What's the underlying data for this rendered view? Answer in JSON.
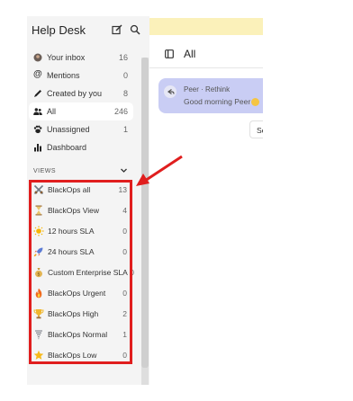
{
  "sidebar": {
    "title": "Help Desk",
    "nav": [
      {
        "label": "Your inbox",
        "count": "16"
      },
      {
        "label": "Mentions",
        "count": "0"
      },
      {
        "label": "Created by you",
        "count": "8"
      },
      {
        "label": "All",
        "count": "246"
      },
      {
        "label": "Unassigned",
        "count": "1"
      },
      {
        "label": "Dashboard",
        "count": ""
      }
    ],
    "views_label": "VIEWS",
    "views": [
      {
        "label": "BlackOps all",
        "count": "13",
        "icon": "crossed-swords-icon"
      },
      {
        "label": "BlackOps View",
        "count": "4",
        "icon": "hourglass-icon"
      },
      {
        "label": "12 hours SLA",
        "count": "0",
        "icon": "sun-icon"
      },
      {
        "label": "24 hours SLA",
        "count": "0",
        "icon": "rocket-icon"
      },
      {
        "label": "Custom Enterprise SLA",
        "count": "0",
        "icon": "money-bag-icon"
      },
      {
        "label": "BlackOps Urgent",
        "count": "0",
        "icon": "fire-icon"
      },
      {
        "label": "BlackOps High",
        "count": "2",
        "icon": "trophy-icon"
      },
      {
        "label": "BlackOps Normal",
        "count": "1",
        "icon": "tornado-icon"
      },
      {
        "label": "BlackOps Low",
        "count": "0",
        "icon": "star-icon"
      }
    ]
  },
  "main": {
    "title": "All",
    "conversation": {
      "sender": "Peer · Rethink",
      "preview": "Good morning Peer"
    },
    "button_partial": "Se"
  },
  "colors": {
    "sidebar_bg": "#f4f4f4",
    "selected_card": "#c9cdf4",
    "top_band": "#fbf1ba",
    "highlight_red": "#e01e1e"
  }
}
